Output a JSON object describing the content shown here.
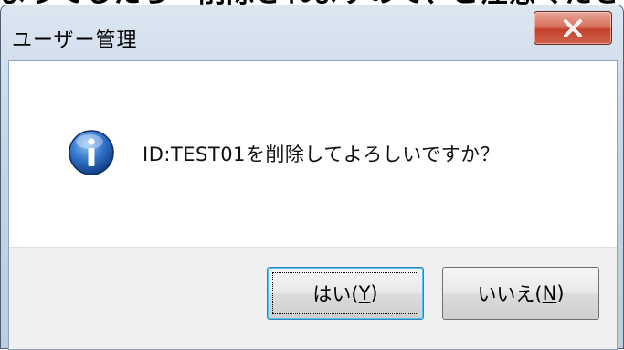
{
  "background_text": "ようでしたら「削除されますので、ご注意ください。",
  "dialog": {
    "title": "ユーザー管理",
    "message": "ID:TEST01を削除してよろしいですか？",
    "buttons": {
      "yes_prefix": "はい(",
      "yes_key": "Y",
      "yes_suffix": ")",
      "no_prefix": "いいえ(",
      "no_key": "N",
      "no_suffix": ")"
    },
    "icon": "information-icon",
    "close_icon": "close-icon"
  },
  "colors": {
    "close_button": "#c3422b",
    "info_icon": "#1f5fb4",
    "frame": "#c7d6e6"
  }
}
